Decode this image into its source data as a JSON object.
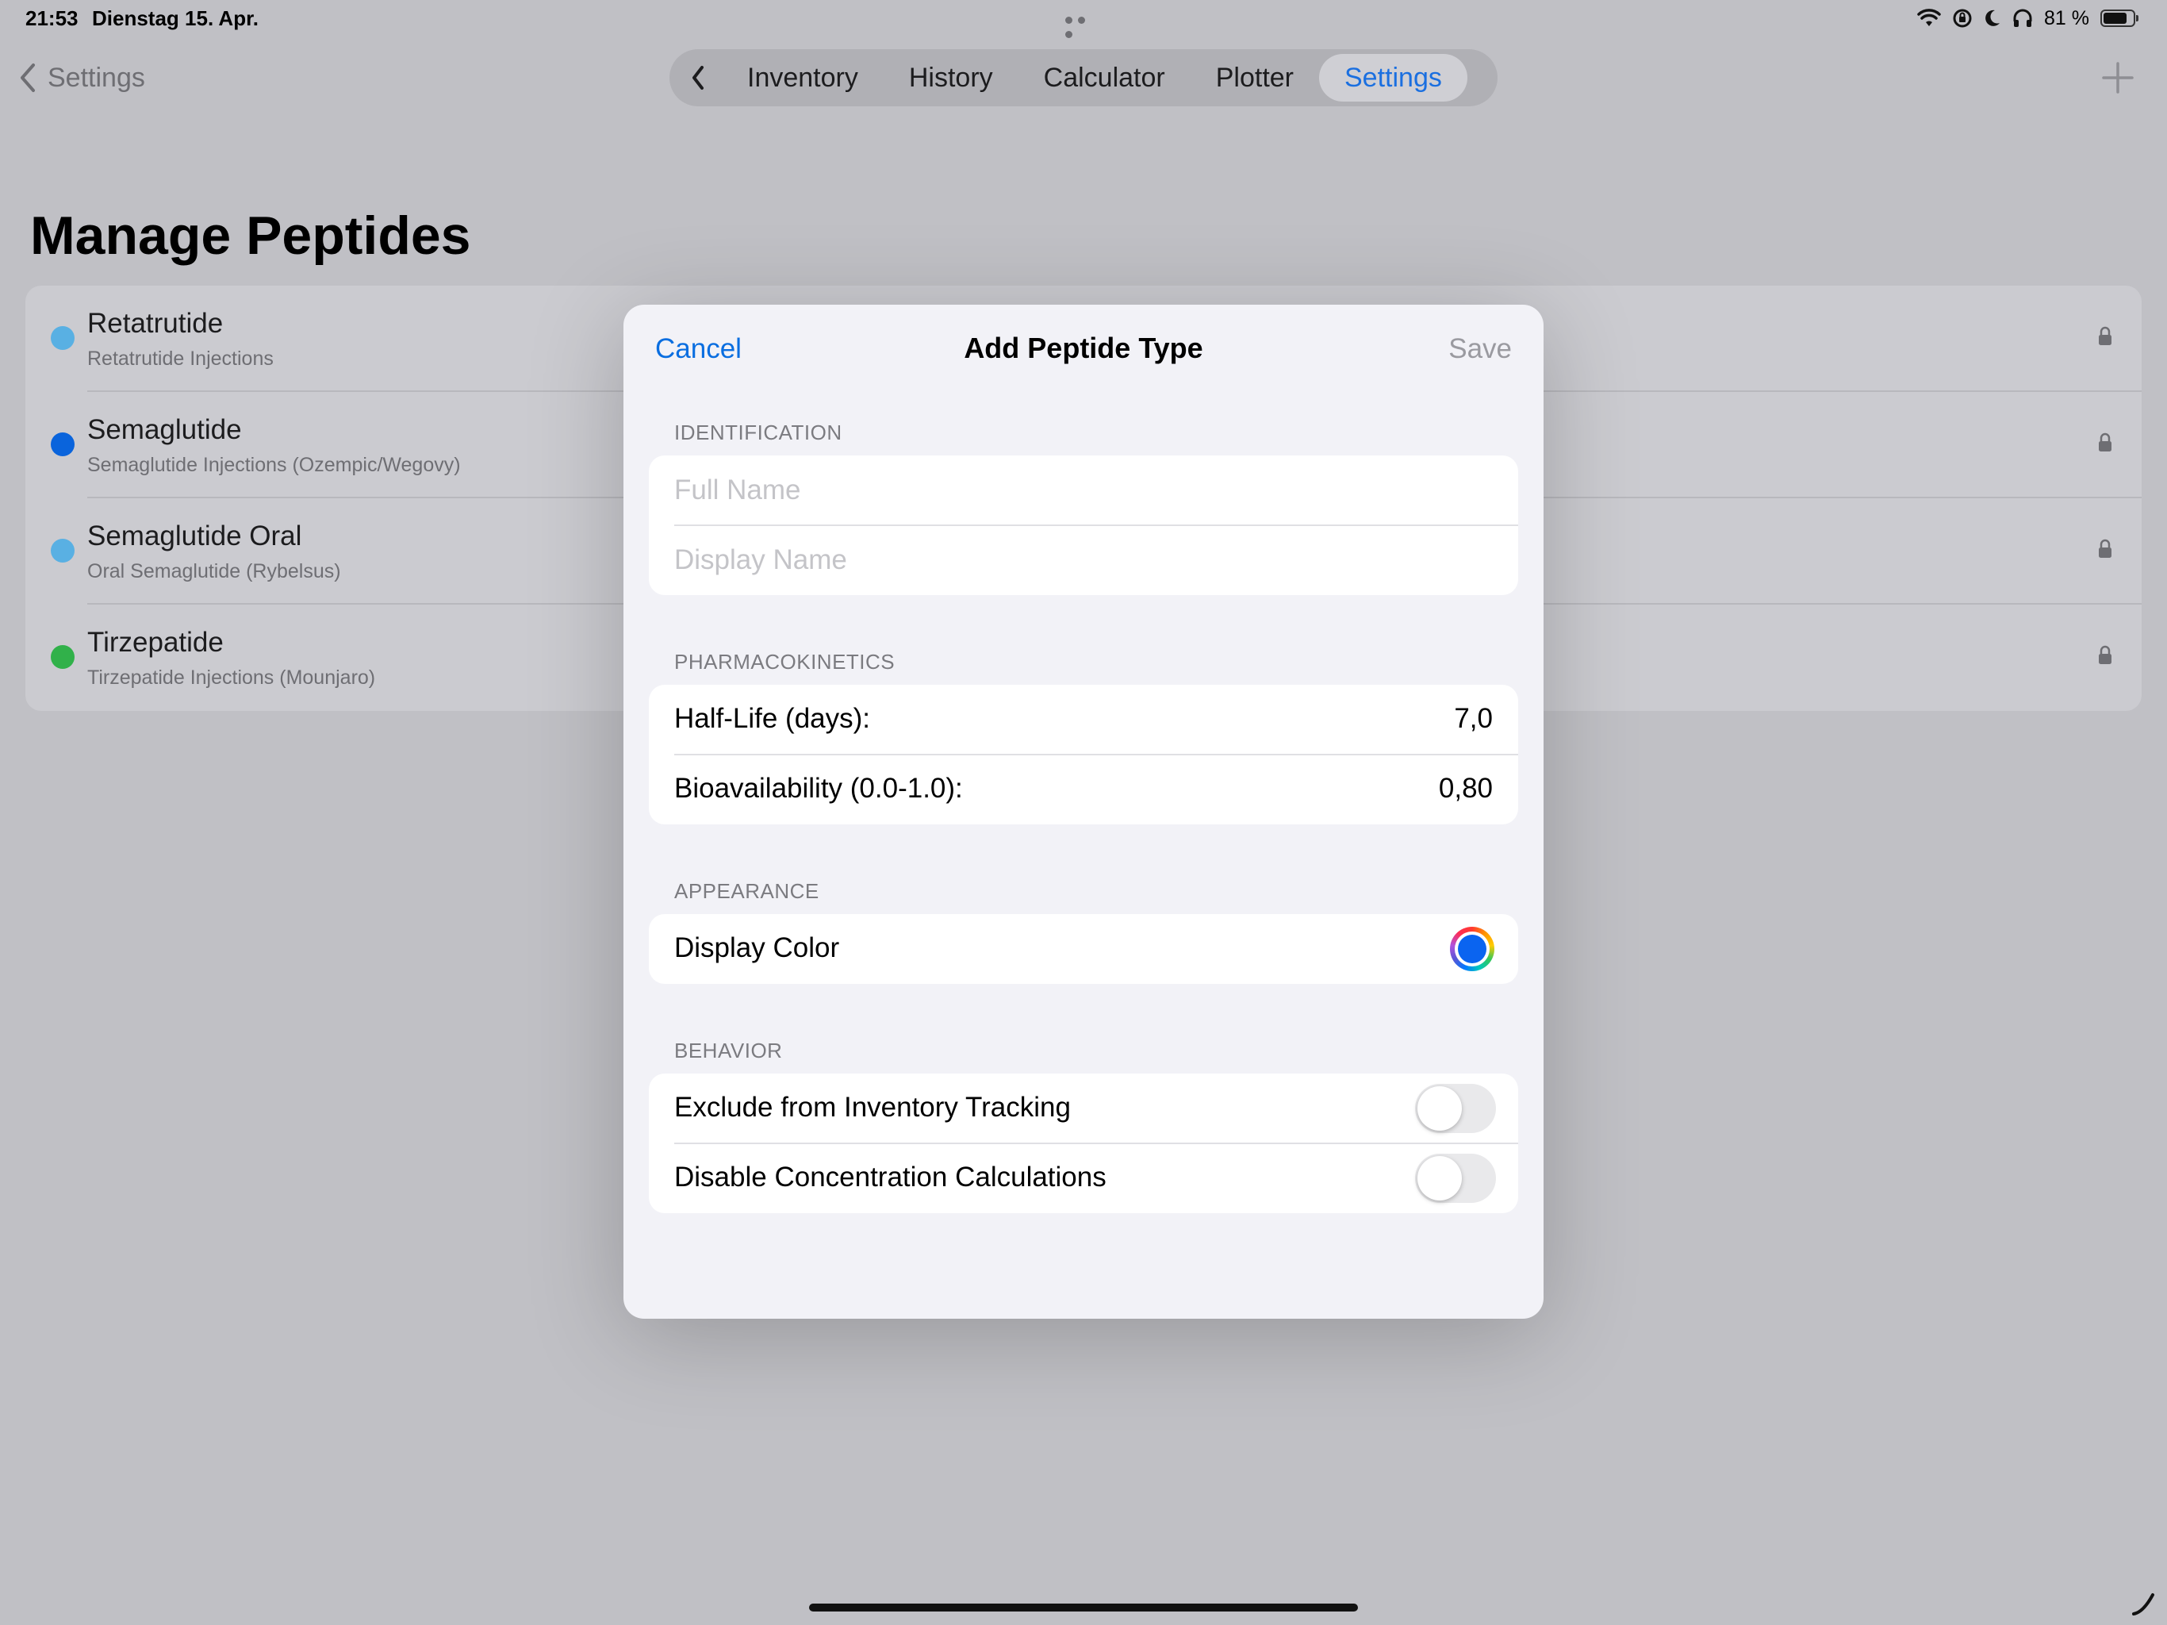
{
  "status_bar": {
    "time": "21:53",
    "date": "Dienstag 15. Apr.",
    "battery_text": "81 %",
    "battery_level": 0.81,
    "icons": [
      "wifi-icon",
      "orientation-lock-icon",
      "moon-icon",
      "headphones-icon",
      "battery-icon"
    ]
  },
  "nav": {
    "back_label": "Settings",
    "tabs": [
      {
        "label": "Inventory",
        "active": false
      },
      {
        "label": "History",
        "active": false
      },
      {
        "label": "Calculator",
        "active": false
      },
      {
        "label": "Plotter",
        "active": false
      },
      {
        "label": "Settings",
        "active": true
      }
    ],
    "add_icon": "plus-icon"
  },
  "page": {
    "title": "Manage Peptides",
    "peptides": [
      {
        "name": "Retatrutide",
        "subtitle": "Retatrutide Injections",
        "color": "#59b0e3",
        "icon": "lock-icon"
      },
      {
        "name": "Semaglutide",
        "subtitle": "Semaglutide Injections (Ozempic/Wegovy)",
        "color": "#0a64dc",
        "icon": "lock-icon"
      },
      {
        "name": "Semaglutide Oral",
        "subtitle": "Oral Semaglutide (Rybelsus)",
        "color": "#59b0e3",
        "icon": "lock-icon"
      },
      {
        "name": "Tirzepatide",
        "subtitle": "Tirzepatide Injections (Mounjaro)",
        "color": "#31b14a",
        "icon": "lock-icon"
      }
    ]
  },
  "modal": {
    "cancel_label": "Cancel",
    "title": "Add Peptide Type",
    "save_label": "Save",
    "identification": {
      "header": "IDENTIFICATION",
      "full_name_placeholder": "Full Name",
      "display_name_placeholder": "Display Name"
    },
    "pharmacokinetics": {
      "header": "PHARMACOKINETICS",
      "half_life_label": "Half-Life (days):",
      "half_life_value": "7,0",
      "bioavailability_label": "Bioavailability (0.0-1.0):",
      "bioavailability_value": "0,80"
    },
    "appearance": {
      "header": "APPEARANCE",
      "display_color_label": "Display Color",
      "display_color_value": "#0a64f0"
    },
    "behavior": {
      "header": "BEHAVIOR",
      "exclude_inventory_label": "Exclude from Inventory Tracking",
      "exclude_inventory_on": false,
      "disable_concentration_label": "Disable Concentration Calculations",
      "disable_concentration_on": false
    }
  },
  "colors": {
    "accent": "#0a6ee0",
    "background": "#c0c0c5",
    "modal_background": "#f2f2f7"
  }
}
